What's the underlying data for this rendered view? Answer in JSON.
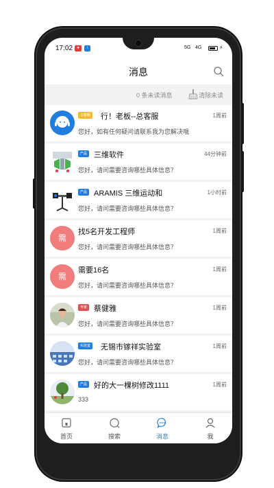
{
  "status_bar": {
    "time": "17:02",
    "app_icon_a": "app-notification-icon",
    "app_icon_b": "upload-icon",
    "signal_1": "5G",
    "signal_2": "4G"
  },
  "header": {
    "title": "消息",
    "search_icon": "search-icon"
  },
  "unread_bar": {
    "count_text": "0 条未读消息",
    "clear_label": "清除未读",
    "clear_icon": "broom-icon"
  },
  "messages": [
    {
      "tag": "云客服",
      "tag_color": "#f5b731",
      "name": "行！老板--总客服",
      "time": "1周前",
      "preview": "您好，如有任何疑问请联系我为您解决哦",
      "avatar": "customer-service-avatar"
    },
    {
      "tag": "产品",
      "tag_color": "#1f7ee0",
      "name": "三维软件",
      "time": "44分钟前",
      "preview": "您好，请问需要咨询哪些具体信息？",
      "avatar": "product-avatar"
    },
    {
      "tag": "产品",
      "tag_color": "#1f7ee0",
      "name": "ARAMIS 三维运动和",
      "time": "1小时前",
      "preview": "您好，请问需要咨询哪些具体信息？",
      "avatar": "product-avatar"
    },
    {
      "tag": "",
      "tag_color": "",
      "name": "找5名开发工程师",
      "time": "1周前",
      "preview": "您好，请问需要咨询哪些具体信息？",
      "avatar": "demand-avatar",
      "avatar_text": "需"
    },
    {
      "tag": "",
      "tag_color": "",
      "name": "需要16名",
      "time": "1周前",
      "preview": "您好，请问需要咨询哪些具体信息？",
      "avatar": "demand-avatar",
      "avatar_text": "需"
    },
    {
      "tag": "专家",
      "tag_color": "#e05252",
      "name": "蔡健雅",
      "time": "1周前",
      "preview": "您好，请问需要咨询哪些具体信息？",
      "avatar": "expert-avatar"
    },
    {
      "tag": "实验室",
      "tag_color": "#1f7ee0",
      "name": "无锡市镓祥实验室",
      "time": "1周前",
      "preview": "您好，请问需要咨询哪些具体信息？",
      "avatar": "lab-avatar"
    },
    {
      "tag": "产品",
      "tag_color": "#1f7ee0",
      "name": "好的大一棵树修改1111",
      "time": "1周前",
      "preview": "333",
      "avatar": "product-avatar"
    }
  ],
  "bottom_nav": [
    {
      "label": "首页",
      "icon": "home-icon",
      "active": false
    },
    {
      "label": "搜索",
      "icon": "search-icon",
      "active": false
    },
    {
      "label": "消息",
      "icon": "chat-icon",
      "active": true
    },
    {
      "label": "我",
      "icon": "user-icon",
      "active": false
    }
  ],
  "colors": {
    "accent": "#1f7ee0",
    "demand_avatar": "#f07c7c",
    "divider": "#f2f2f2"
  }
}
